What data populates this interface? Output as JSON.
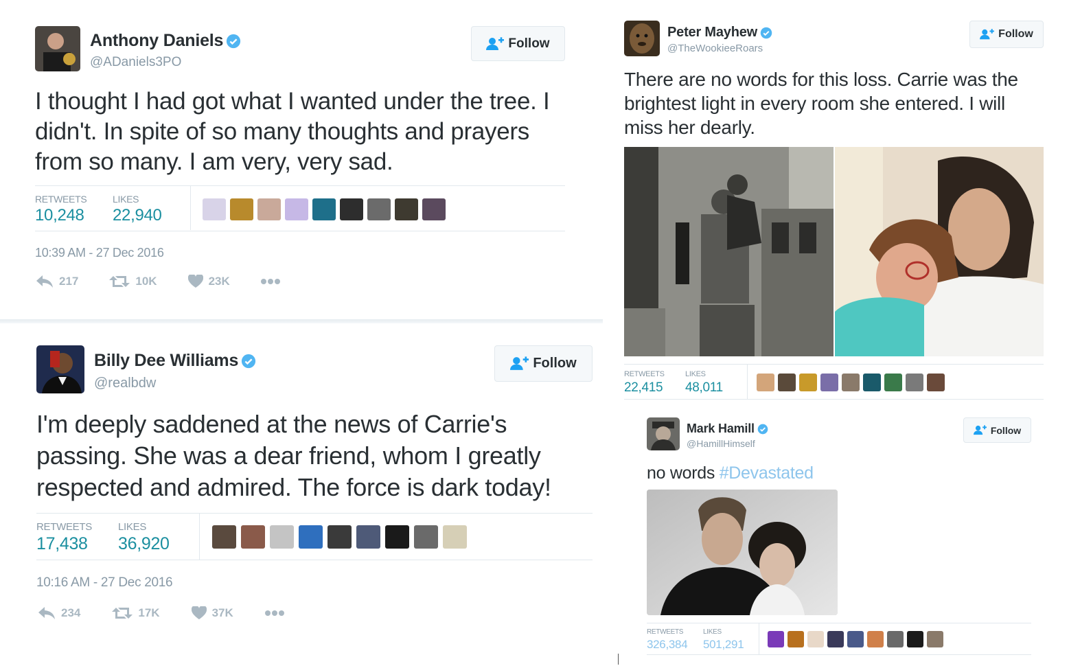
{
  "follow_label": "Follow",
  "labels": {
    "retweets": "RETWEETS",
    "likes": "LIKES"
  },
  "colors": {
    "accent_blue": "#1da1f2",
    "stat_teal": "#1b8fa0",
    "muted": "#8899a6",
    "hashtag": "#8ec5ec"
  },
  "tweets": [
    {
      "name": "Anthony Daniels",
      "handle": "@ADaniels3PO",
      "text": "I thought I had got what I wanted under the tree. I didn't. In spite of so many thoughts and prayers from so many. I am very, very sad.",
      "retweets": "10,248",
      "likes": "22,940",
      "timestamp": "10:39 AM - 27 Dec 2016",
      "replies": "217",
      "rt_count": "10K",
      "like_count": "23K"
    },
    {
      "name": "Billy Dee Williams",
      "handle": "@realbdw",
      "text": "I'm deeply saddened at the news of Carrie's passing. She was a dear friend, whom I greatly respected and admired. The force is dark today!",
      "retweets": "17,438",
      "likes": "36,920",
      "timestamp": "10:16 AM - 27 Dec 2016",
      "replies": "234",
      "rt_count": "17K",
      "like_count": "37K"
    },
    {
      "name": "Peter Mayhew",
      "handle": "@TheWookieeRoars",
      "text": "There are no words for this loss. Carrie was the brightest light in every room she entered. I will miss her dearly.",
      "retweets": "22,415",
      "likes": "48,011"
    },
    {
      "name": "Mark Hamill",
      "handle": "@HamillHimself",
      "text": "no words ",
      "hashtag": "#Devastated",
      "retweets": "326,384",
      "likes": "501,291"
    }
  ]
}
